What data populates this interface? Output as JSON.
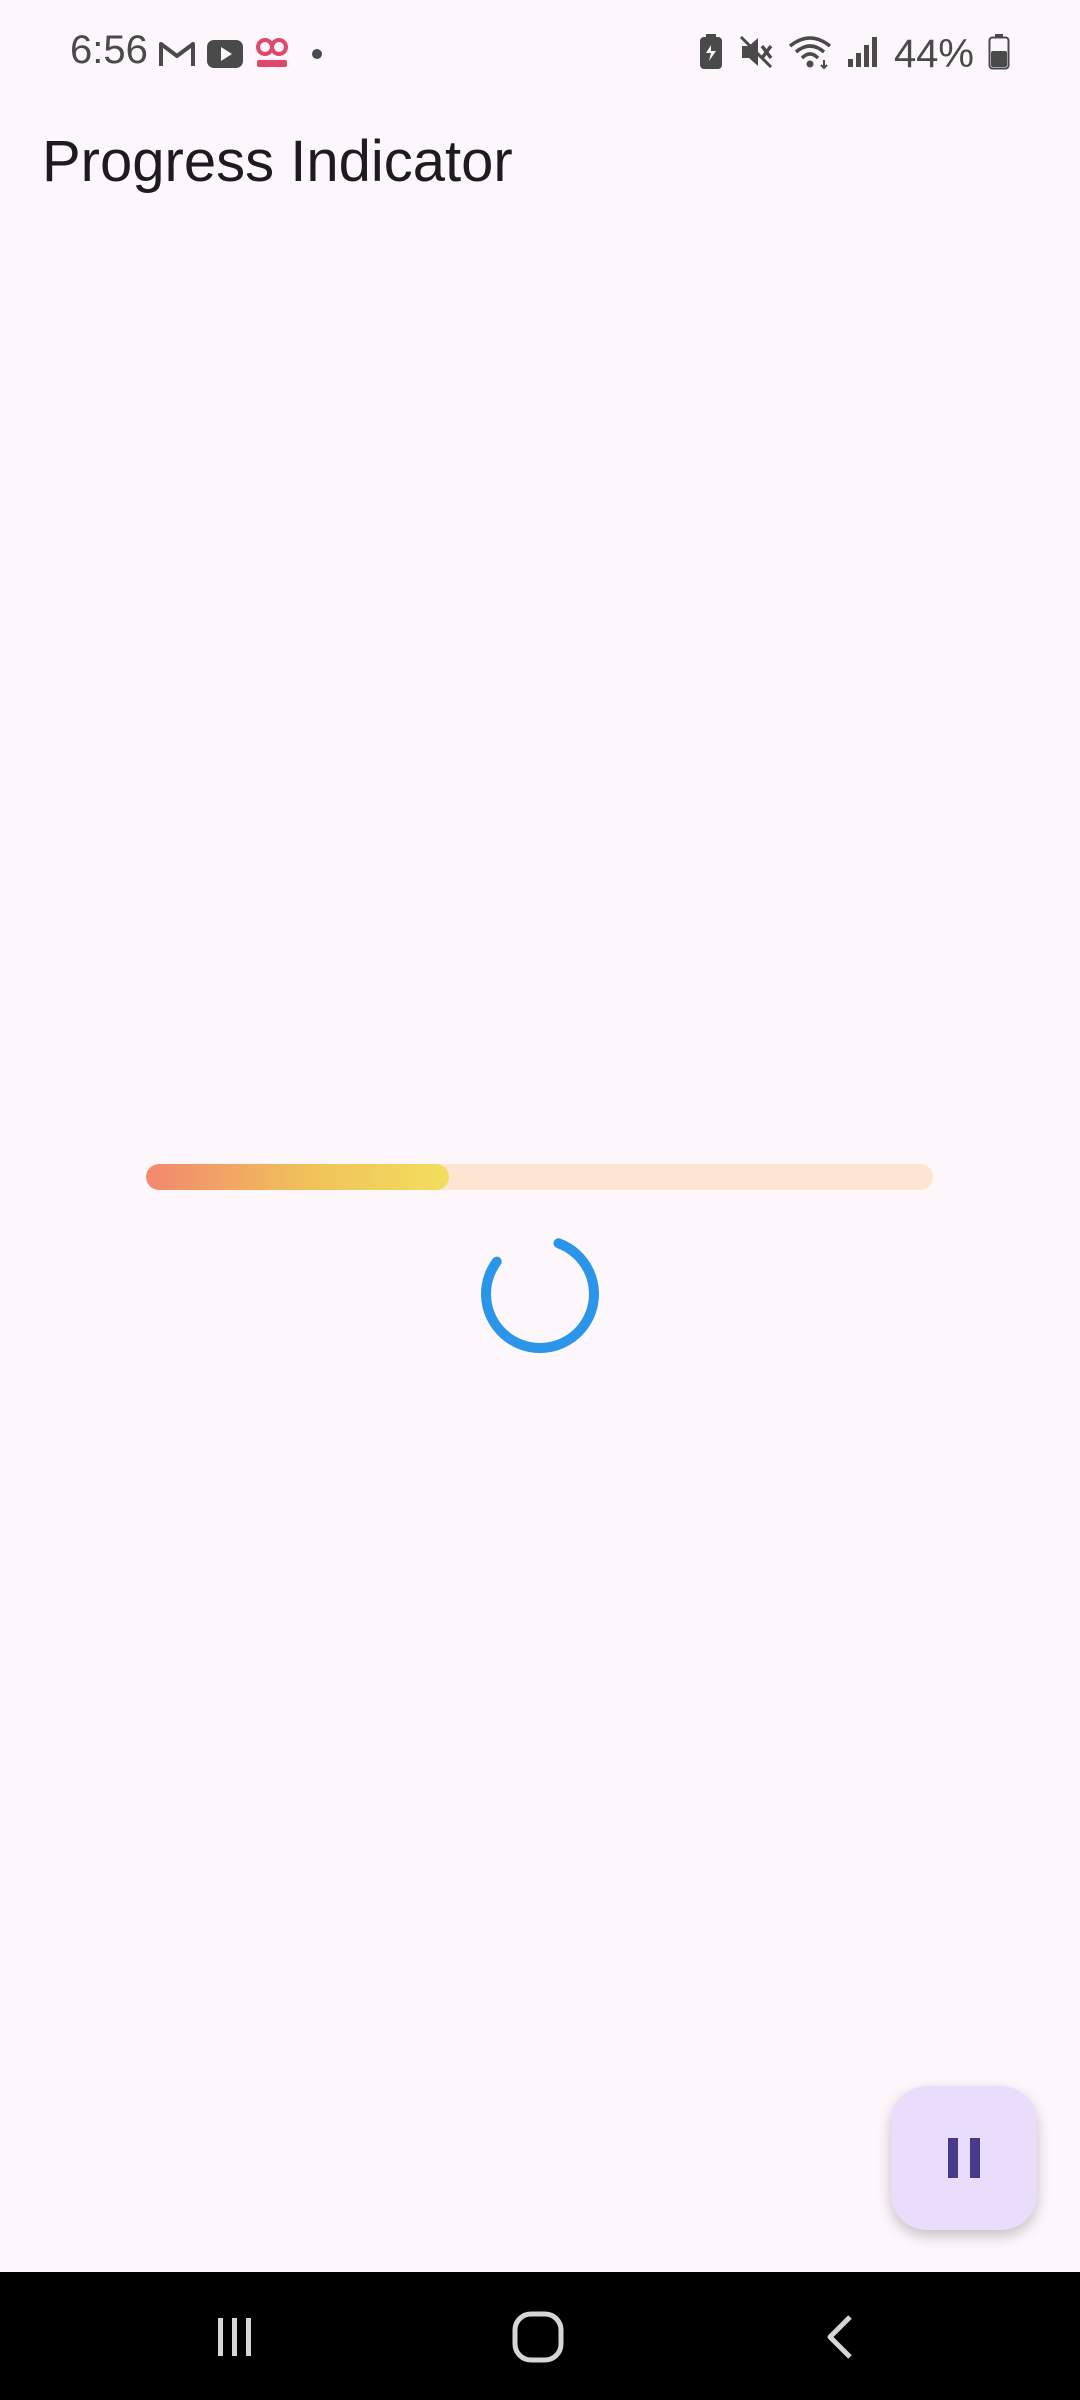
{
  "status_bar": {
    "time": "6:56",
    "notification_icons": [
      "gmail-icon",
      "youtube-icon",
      "hood-app-icon",
      "dot-icon"
    ],
    "system_icons": [
      "battery-saver-icon",
      "mute-icon",
      "wifi-icon",
      "signal-icon"
    ],
    "battery_percent": "44%"
  },
  "app_bar": {
    "title": "Progress Indicator"
  },
  "linear_progress": {
    "value": 0.385,
    "track_color": "#fde5d2",
    "fill_gradient": [
      "#f3886e",
      "#f2de5c"
    ]
  },
  "circular_progress": {
    "color": "#2b95e9",
    "state": "indeterminate"
  },
  "fab": {
    "icon": "pause-icon",
    "background": "#eaddfb",
    "icon_color": "#4a3a8c"
  },
  "nav_bar": {
    "items": [
      "recent-apps-icon",
      "home-icon",
      "back-icon"
    ]
  }
}
